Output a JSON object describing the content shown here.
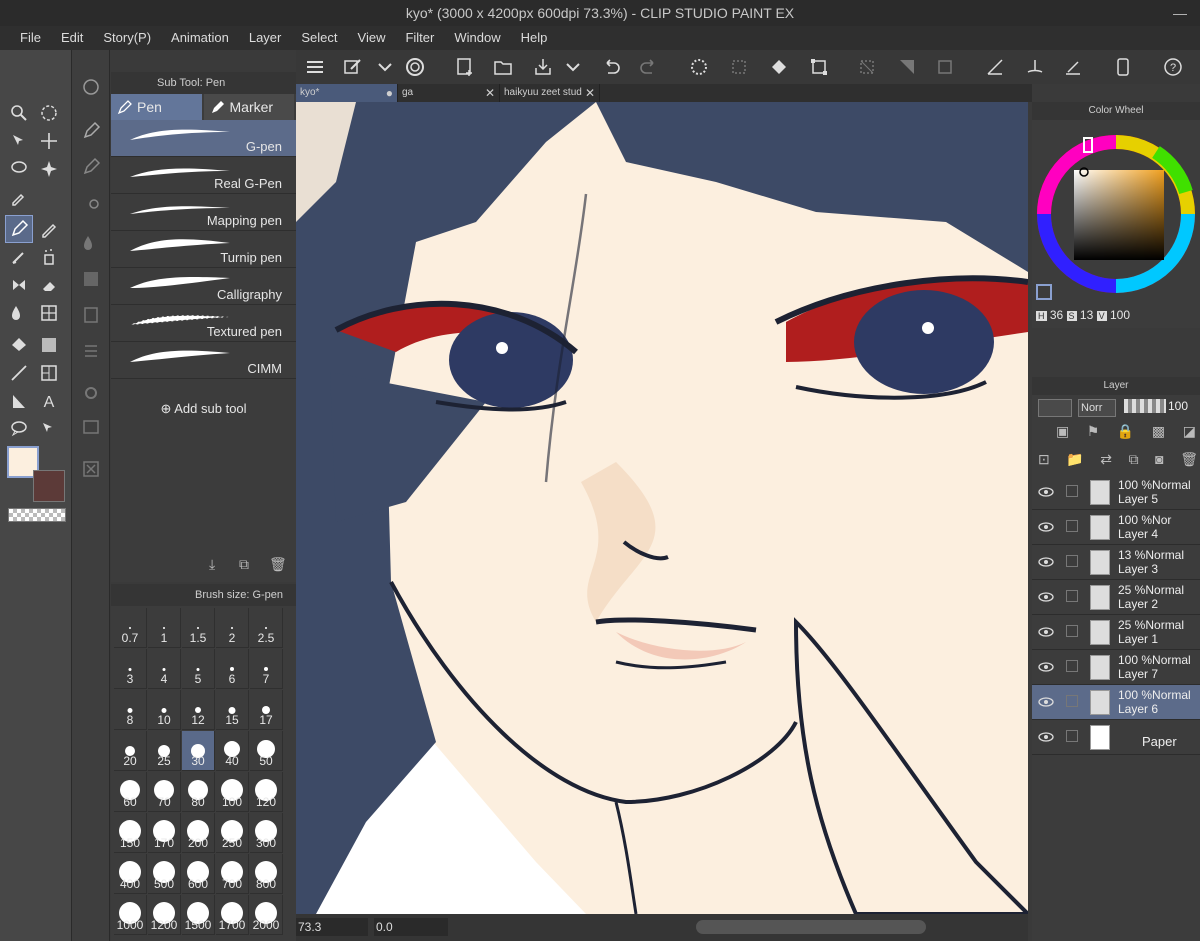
{
  "window": {
    "title": "kyo* (3000 x 4200px 600dpi 73.3%) - CLIP STUDIO PAINT EX"
  },
  "menu": [
    "File",
    "Edit",
    "Story(P)",
    "Animation",
    "Layer",
    "Select",
    "View",
    "Filter",
    "Window",
    "Help"
  ],
  "subtool_panel": {
    "header": "Sub Tool: Pen",
    "tabs": [
      "Pen",
      "Marker"
    ],
    "items": [
      "G-pen",
      "Real G-Pen",
      "Mapping pen",
      "Turnip pen",
      "Calligraphy",
      "Textured pen",
      "CIMM"
    ],
    "add_label": "Add sub tool"
  },
  "brush_panel": {
    "header": "Brush size: G-pen",
    "sizes": [
      "0.7",
      "1",
      "1.5",
      "2",
      "2.5",
      "3",
      "4",
      "5",
      "6",
      "7",
      "8",
      "10",
      "12",
      "15",
      "17",
      "20",
      "25",
      "30",
      "40",
      "50",
      "60",
      "70",
      "80",
      "100",
      "120",
      "150",
      "170",
      "200",
      "250",
      "300",
      "400",
      "500",
      "600",
      "700",
      "800",
      "1000",
      "1200",
      "1500",
      "1700",
      "2000"
    ],
    "selected": "30"
  },
  "doc_tabs": [
    {
      "label": "kyo*",
      "mark": "●"
    },
    {
      "label": "ga",
      "mark": "✕"
    },
    {
      "label": "haikyuu zeet stud",
      "mark": "✕"
    }
  ],
  "status": {
    "zoom": "73.3",
    "angle": "0.0"
  },
  "color_wheel": {
    "title": "Color Wheel",
    "h_label": "H",
    "h": "36",
    "s_label": "S",
    "s": "13",
    "v_label": "V",
    "v": "100",
    "main_color": "#FCEFDF",
    "sub_color": "#5C3A38"
  },
  "layer_panel": {
    "title": "Layer",
    "blend": "Norr",
    "opacity": "100",
    "layers": [
      {
        "mode": "100 %Normal",
        "name": "Layer 5"
      },
      {
        "mode": "100 %Nor",
        "name": "Layer 4"
      },
      {
        "mode": "13 %Normal",
        "name": "Layer 3"
      },
      {
        "mode": "25 %Normal",
        "name": "Layer 2"
      },
      {
        "mode": "25 %Normal",
        "name": "Layer 1"
      },
      {
        "mode": "100 %Normal",
        "name": "Layer 7"
      },
      {
        "mode": "100 %Normal",
        "name": "Layer 6"
      }
    ],
    "paper": "Paper",
    "selected": "Layer 6"
  }
}
